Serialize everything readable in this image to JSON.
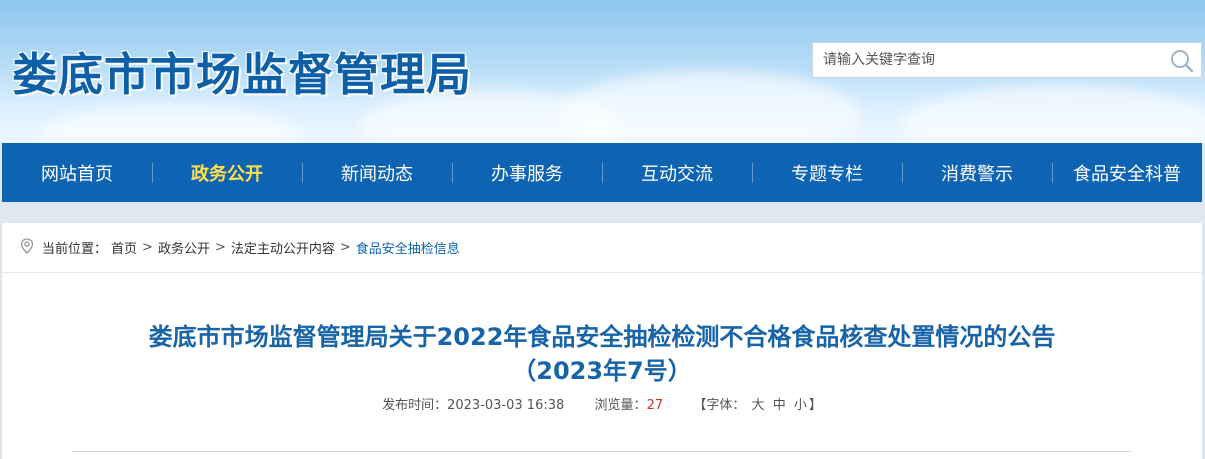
{
  "header": {
    "site_title": "娄底市市场监督管理局",
    "search_placeholder": "请输入关键字查询"
  },
  "nav": {
    "items": [
      {
        "label": "网站首页"
      },
      {
        "label": "政务公开"
      },
      {
        "label": "新闻动态"
      },
      {
        "label": "办事服务"
      },
      {
        "label": "互动交流"
      },
      {
        "label": "专题专栏"
      },
      {
        "label": "消费警示"
      },
      {
        "label": "食品安全科普"
      }
    ],
    "active_index": 1
  },
  "breadcrumb": {
    "prefix": "当前位置：",
    "items": [
      "首页",
      "政务公开",
      "法定主动公开内容",
      "食品安全抽检信息"
    ],
    "separator": ">"
  },
  "article": {
    "title_line1": "娄底市市场监督管理局关于2022年食品安全抽检检测不合格食品核查处置情况的公告",
    "title_line2": "（2023年7号）",
    "publish_label": "发布时间：",
    "publish_time": "2023-03-03 16:38",
    "views_label": "浏览量：",
    "views_count": "27",
    "font_prefix": "【字体：",
    "font_large": "大",
    "font_medium": "中",
    "font_small": "小",
    "font_suffix": "】"
  },
  "colors": {
    "nav_bg": "#0e64b3",
    "nav_active": "#ffe14a",
    "title_blue": "#1864a8",
    "site_title": "#0d5fa8"
  }
}
